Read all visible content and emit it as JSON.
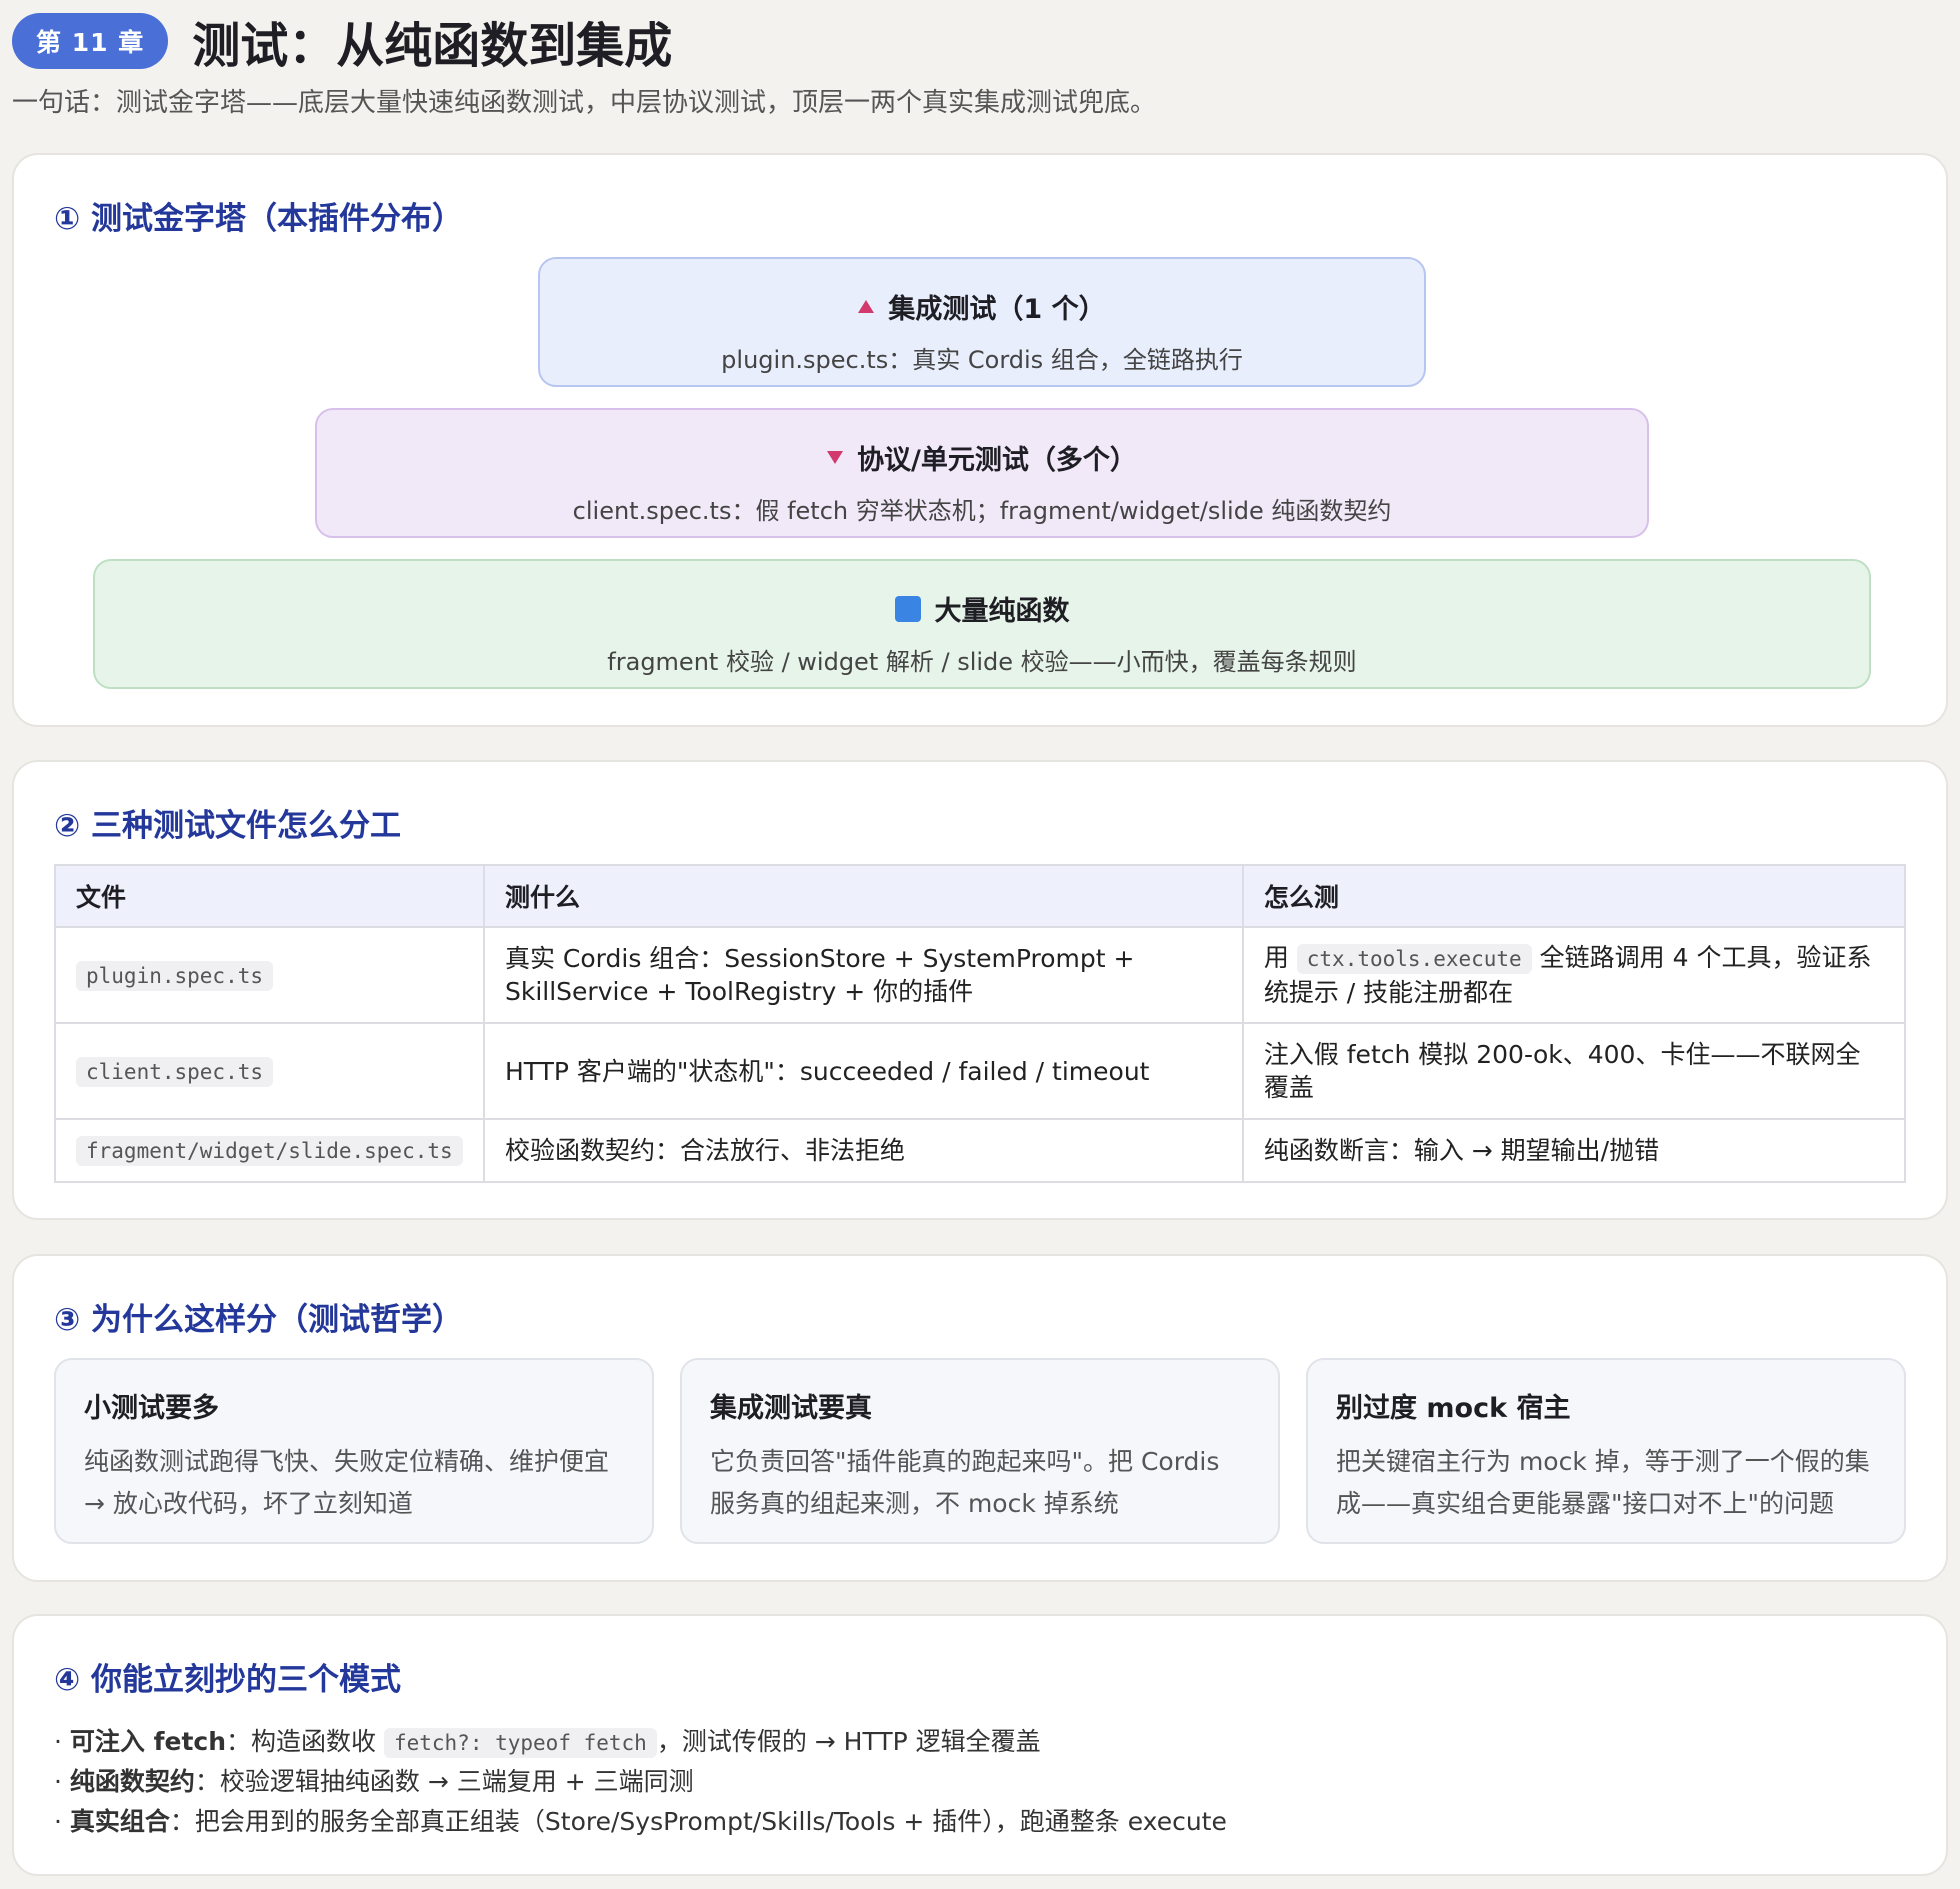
{
  "header": {
    "chapter": "第 11 章",
    "title": "测试：从纯函数到集成",
    "summary": "一句话：测试金字塔——底层大量快速纯函数测试，中层协议测试，顶层一两个真实集成测试兜底。"
  },
  "pyramid": {
    "title": "① 测试金字塔（本插件分布）",
    "layers": [
      {
        "icon": "triangle-up-icon",
        "title": "集成测试（1 个）",
        "desc": "plugin.spec.ts：真实 Cordis 组合，全链路执行"
      },
      {
        "icon": "triangle-down-icon",
        "title": "协议/单元测试（多个）",
        "desc": "client.spec.ts：假 fetch 穷举状态机；fragment/widget/slide 纯函数契约"
      },
      {
        "icon": "blue-square-icon",
        "title": "大量纯函数",
        "desc": "fragment 校验 / widget 解析 / slide 校验——小而快，覆盖每条规则"
      }
    ]
  },
  "files": {
    "title": "② 三种测试文件怎么分工",
    "headers": [
      "文件",
      "测什么",
      "怎么测"
    ],
    "rows": [
      {
        "file": "plugin.spec.ts",
        "what": "真实 Cordis 组合：SessionStore + SystemPrompt + SkillService + ToolRegistry + 你的插件",
        "how_pre": "用 ",
        "how_code": "ctx.tools.execute",
        "how_post": " 全链路调用 4 个工具，验证系统提示 / 技能注册都在"
      },
      {
        "file": "client.spec.ts",
        "what": "HTTP 客户端的\"状态机\"：succeeded / failed / timeout",
        "how": "注入假 fetch 模拟 200-ok、400、卡住——不联网全覆盖"
      },
      {
        "file": "fragment/widget/slide.spec.ts",
        "what": "校验函数契约：合法放行、非法拒绝",
        "how": "纯函数断言：输入 → 期望输出/抛错"
      }
    ]
  },
  "philosophy": {
    "title": "③ 为什么这样分（测试哲学）",
    "cards": [
      {
        "title": "小测试要多",
        "text": "纯函数测试跑得飞快、失败定位精确、维护便宜 → 放心改代码，坏了立刻知道"
      },
      {
        "title": "集成测试要真",
        "text": "它负责回答\"插件能真的跑起来吗\"。把 Cordis 服务真的组起来测，不 mock 掉系统"
      },
      {
        "title": "别过度 mock 宿主",
        "text": "把关键宿主行为 mock 掉，等于测了一个假的集成——真实组合更能暴露\"接口对不上\"的问题"
      }
    ]
  },
  "patterns": {
    "title": "④ 你能立刻抄的三个模式",
    "items": [
      {
        "bullet": "· ",
        "label": "可注入 fetch",
        "pre": "：构造函数收 ",
        "code": "fetch?: typeof fetch",
        "post": "，测试传假的 → HTTP 逻辑全覆盖"
      },
      {
        "bullet": "· ",
        "label": "纯函数契约",
        "pre": "：校验逻辑抽纯函数 → 三端复用 + 三端同测"
      },
      {
        "bullet": "· ",
        "label": "真实组合",
        "pre": "：把会用到的服务全部真正组装（Store/SysPrompt/Skills/Tools + 插件），跑通整条 execute"
      }
    ]
  },
  "colors": {
    "accent": "#4a6fd6",
    "section_title": "#23389a",
    "triangle": "#d23a6e",
    "square": "#3a84e4"
  }
}
